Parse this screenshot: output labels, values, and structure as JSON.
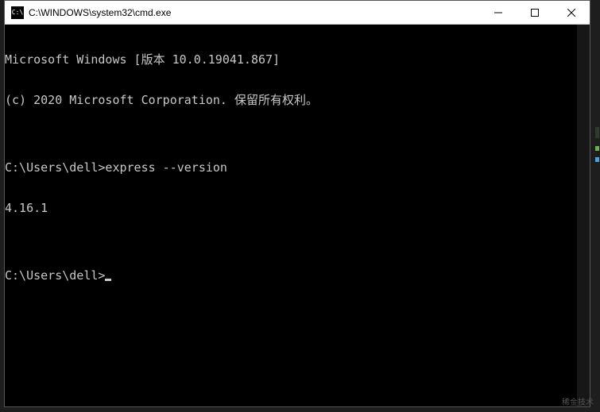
{
  "titlebar": {
    "icon_label": "cmd-icon",
    "title": "C:\\WINDOWS\\system32\\cmd.exe",
    "minimize": "—",
    "maximize": "□",
    "close": "✕"
  },
  "terminal": {
    "lines": [
      "Microsoft Windows [版本 10.0.19041.867]",
      "(c) 2020 Microsoft Corporation. 保留所有权利。",
      "",
      "C:\\Users\\dell>express --version",
      "4.16.1",
      "",
      "C:\\Users\\dell>"
    ]
  },
  "watermark": "稀金技术"
}
